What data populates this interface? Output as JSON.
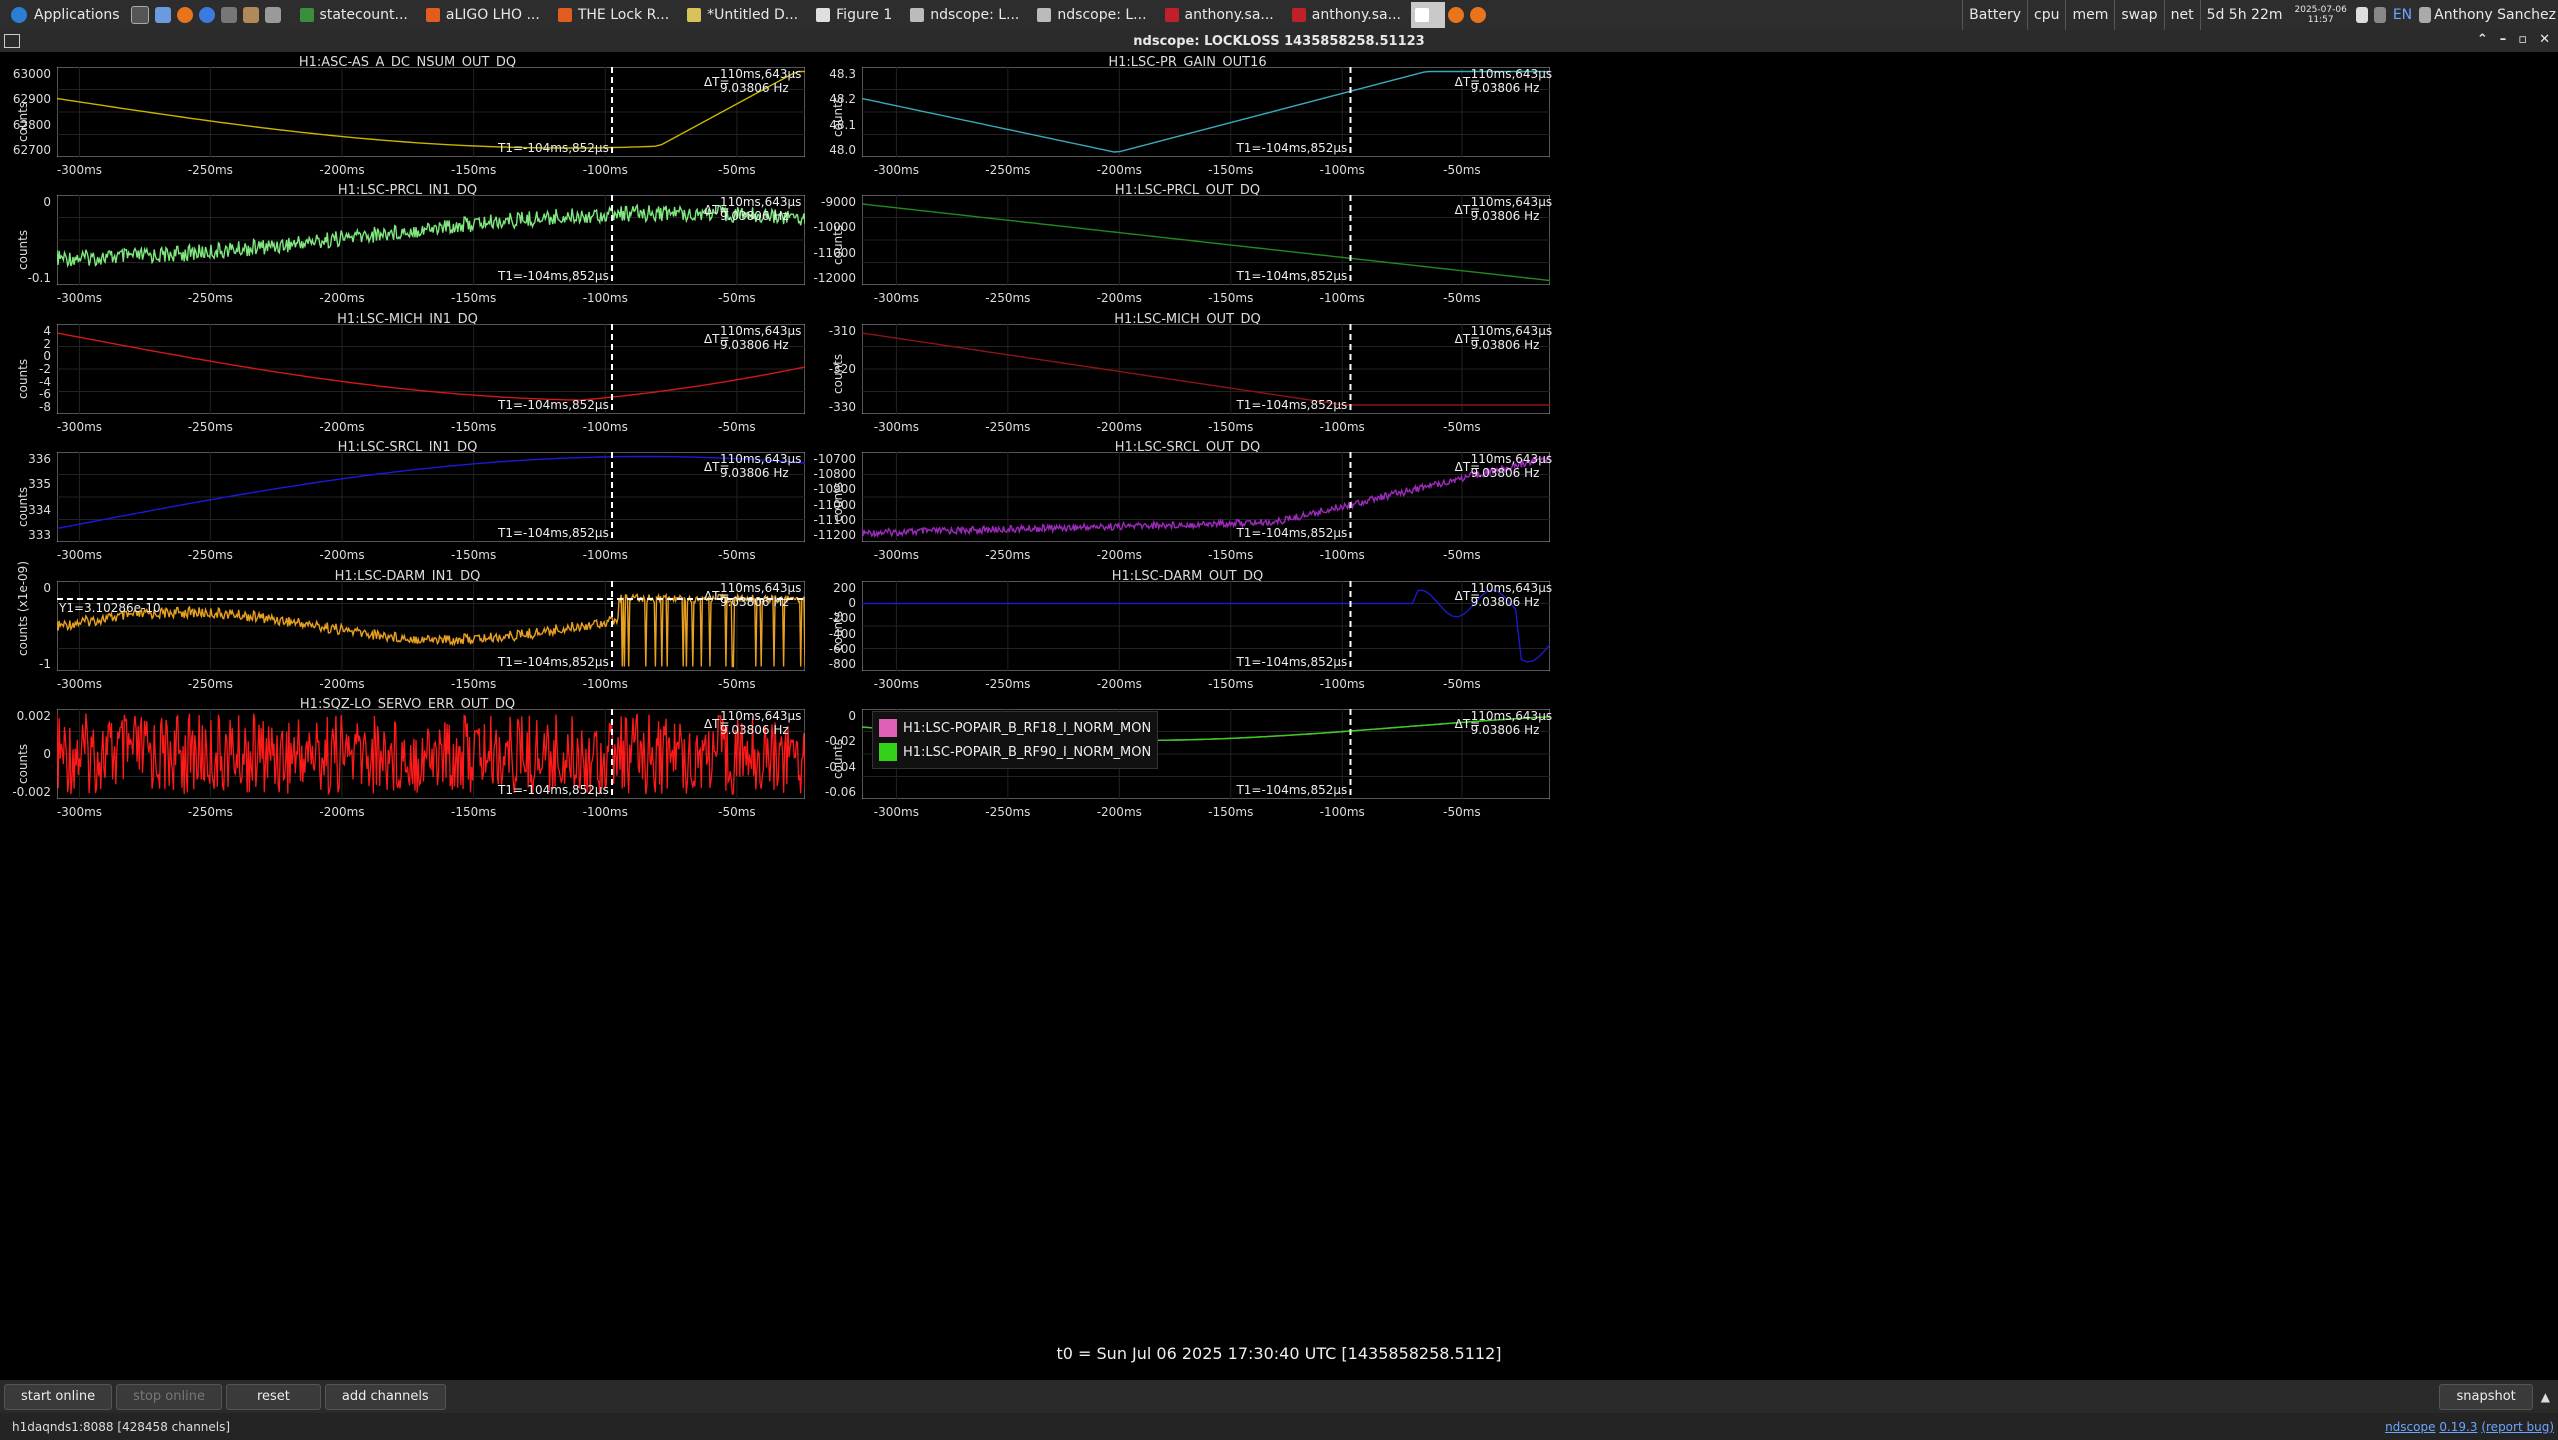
{
  "taskbar": {
    "applications": "Applications",
    "windows": [
      {
        "label": "statecount...",
        "color": "#3a8f3a"
      },
      {
        "label": "aLIGO LHO ...",
        "color": "#e25b1f"
      },
      {
        "label": "THE Lock R...",
        "color": "#e25b1f"
      },
      {
        "label": "*Untitled D...",
        "color": "#d8c25a"
      },
      {
        "label": "Figure 1",
        "color": "#e0e0e0"
      },
      {
        "label": "ndscope: L...",
        "color": "#bbbbbb"
      },
      {
        "label": "ndscope: L...",
        "color": "#bbbbbb"
      },
      {
        "label": "anthony.sa...",
        "color": "#c0202a"
      },
      {
        "label": "anthony.sa...",
        "color": "#c0202a"
      }
    ],
    "battery": "Battery",
    "cpu": "cpu",
    "mem": "mem",
    "swap": "swap",
    "net": "net",
    "uptime": "5d 5h 22m",
    "date": "2025-07-06",
    "time": "11:57",
    "lang": "EN",
    "user": "Anthony Sanchez"
  },
  "window": {
    "title": "ndscope: LOCKLOSS 1435858258.51123"
  },
  "cursor": {
    "t1": "T1=-104ms,852µs",
    "dt_label": "ΔT=",
    "dt_val": "110ms,643µs",
    "freq": "9.03806 Hz"
  },
  "xticks": [
    "-300ms",
    "-250ms",
    "-200ms",
    "-150ms",
    "-100ms",
    "-50ms"
  ],
  "plots": [
    {
      "title": "H1:ASC-AS_A_DC_NSUM_OUT_DQ",
      "ylabel": "counts",
      "yticks": [
        "63000",
        "62900",
        "62800",
        "62700"
      ],
      "color": "#c8b400"
    },
    {
      "title": "H1:LSC-PR_GAIN_OUT16",
      "ylabel": "counts",
      "yticks": [
        "48.3",
        "48.2",
        "48.1",
        "48.0"
      ],
      "color": "#3aa9b8"
    },
    {
      "title": "H1:LSC-PRCL_IN1_DQ",
      "ylabel": "counts",
      "yticks": [
        "0",
        "-0.1"
      ],
      "color": "#7fe87f"
    },
    {
      "title": "H1:LSC-PRCL_OUT_DQ",
      "ylabel": "counts",
      "yticks": [
        "-9000",
        "-10000",
        "-11000",
        "-12000"
      ],
      "color": "#1f8a1f"
    },
    {
      "title": "H1:LSC-MICH_IN1_DQ",
      "ylabel": "counts",
      "yticks": [
        "4",
        "2",
        "0",
        "-2",
        "-4",
        "-6",
        "-8"
      ],
      "color": "#d01818"
    },
    {
      "title": "H1:LSC-MICH_OUT_DQ",
      "ylabel": "counts",
      "yticks": [
        "-310",
        "-320",
        "-330"
      ],
      "color": "#8a1515"
    },
    {
      "title": "H1:LSC-SRCL_IN1_DQ",
      "ylabel": "counts",
      "yticks": [
        "336",
        "335",
        "334",
        "333"
      ],
      "color": "#1a1adc"
    },
    {
      "title": "H1:LSC-SRCL_OUT_DQ",
      "ylabel": "counts",
      "yticks": [
        "-10700",
        "-10800",
        "-10900",
        "-11000",
        "-11100",
        "-11200"
      ],
      "color": "#9a2ab8"
    },
    {
      "title": "H1:LSC-DARM_IN1_DQ",
      "ylabel": "counts (x1e-09)",
      "yticks": [
        "0",
        "-1"
      ],
      "color": "#e8a020",
      "ycursor": "Y1=3.10286e-10"
    },
    {
      "title": "H1:LSC-DARM_OUT_DQ",
      "ylabel": "counts",
      "yticks": [
        "200",
        "0",
        "-200",
        "-400",
        "-600",
        "-800"
      ],
      "color": "#1a1ac8"
    },
    {
      "title": "H1:SQZ-LO_SERVO_ERR_OUT_DQ",
      "ylabel": "counts",
      "yticks": [
        "0.002",
        "0",
        "-0.002"
      ],
      "color": "#ff1a1a"
    },
    {
      "title": "",
      "ylabel": "counts",
      "yticks": [
        "0",
        "-0.02",
        "-0.04",
        "-0.06"
      ],
      "color": "#e070c0",
      "legend": [
        {
          "label": "H1:LSC-POPAIR_B_RF18_I_NORM_MON",
          "color": "#e060b8"
        },
        {
          "label": "H1:LSC-POPAIR_B_RF90_I_NORM_MON",
          "color": "#33d11a"
        }
      ]
    }
  ],
  "t0": "t0 = Sun Jul 06 2025 17:30:40 UTC [1435858258.5112]",
  "buttons": {
    "start_online": "start online",
    "stop_online": "stop online",
    "reset": "reset",
    "add_channels": "add channels",
    "snapshot": "snapshot"
  },
  "status": {
    "server": "h1daqnds1:8088  [428458 channels]",
    "version_prefix": "ndscope",
    "version": "0.19.3",
    "report": "(report bug)"
  }
}
